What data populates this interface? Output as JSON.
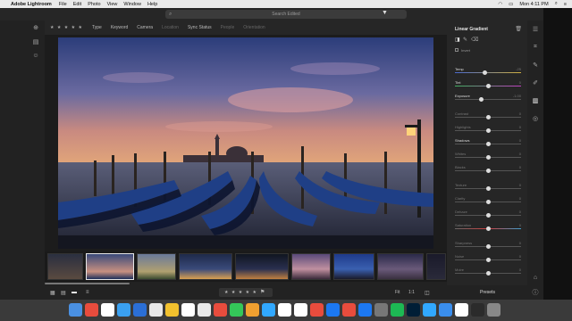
{
  "menubar": {
    "app": "Adobe Lightroom",
    "items": [
      "File",
      "Edit",
      "Photo",
      "View",
      "Window",
      "Help"
    ],
    "clock": "Mon 4:11 PM"
  },
  "search": {
    "placeholder": "Search Edited"
  },
  "filterbar": {
    "stars": "★ ★ ★ ★ ★",
    "filters": [
      "Type",
      "Keyword",
      "Camera",
      "Location",
      "Sync Status",
      "People",
      "Orientation"
    ]
  },
  "edit_panel": {
    "title": "Linear Gradient",
    "mode_label": "Invert",
    "sliders": [
      {
        "label": "Temp",
        "value": "-25",
        "level": 0.45
      },
      {
        "label": "Tint",
        "value": "0",
        "level": 0.5
      },
      {
        "label": "Exposure",
        "value": "-1.00",
        "level": 0.4
      },
      {
        "label": "Contrast",
        "value": "0",
        "level": 0.5
      },
      {
        "label": "Highlights",
        "value": "0",
        "level": 0.5
      },
      {
        "label": "Shadows",
        "value": "0",
        "level": 0.5
      },
      {
        "label": "Whites",
        "value": "0",
        "level": 0.5
      },
      {
        "label": "Blacks",
        "value": "0",
        "level": 0.5
      },
      {
        "label": "Texture",
        "value": "0",
        "level": 0.5
      },
      {
        "label": "Clarity",
        "value": "0",
        "level": 0.5
      },
      {
        "label": "Dehaze",
        "value": "0",
        "level": 0.5
      },
      {
        "label": "Saturation",
        "value": "0",
        "level": 0.5
      },
      {
        "label": "Sharpness",
        "value": "0",
        "level": 0.5
      },
      {
        "label": "Noise",
        "value": "0",
        "level": 0.5
      },
      {
        "label": "Moire",
        "value": "0",
        "level": 0.5
      }
    ]
  },
  "bottombar": {
    "stars": "★ ★ ★ ★ ★",
    "fit": "Fit",
    "zoom": "1:1",
    "presets": "Presets"
  },
  "dock_colors": [
    "#4a90e2",
    "#e84c3d",
    "#ffffff",
    "#3aa0f0",
    "#2b6fd6",
    "#e9e9e9",
    "#f2c12e",
    "#ffffff",
    "#e9e9e9",
    "#e84c3d",
    "#34c759",
    "#f0a030",
    "#31a8ff",
    "#ffffff",
    "#ffffff",
    "#e84c3d",
    "#1c78f2",
    "#e84c3d",
    "#1c78f2",
    "#777777",
    "#1db954",
    "#001e36",
    "#31a8ff",
    "#3a8eed",
    "#ffffff",
    "#2b2b2b",
    "#888888"
  ]
}
